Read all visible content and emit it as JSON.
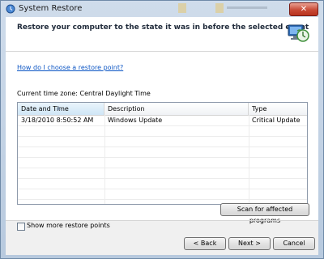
{
  "window": {
    "title": "System Restore",
    "close_glyph": "✕"
  },
  "header": {
    "heading": "Restore your computer to the state it was in before the selected event",
    "icon": "system-restore-icon"
  },
  "help_link": "How do I choose a restore point?",
  "timezone": "Current time zone: Central Daylight Time",
  "table": {
    "columns": [
      "Date and Time",
      "Description",
      "Type"
    ],
    "rows": [
      {
        "date": "3/18/2010 8:50:52 AM",
        "description": "Windows Update",
        "type": "Critical Update"
      }
    ]
  },
  "show_more": {
    "label": "Show more restore points",
    "checked": false
  },
  "buttons": {
    "scan": "Scan for affected programs",
    "back": "< Back",
    "next": "Next >",
    "cancel": "Cancel"
  }
}
